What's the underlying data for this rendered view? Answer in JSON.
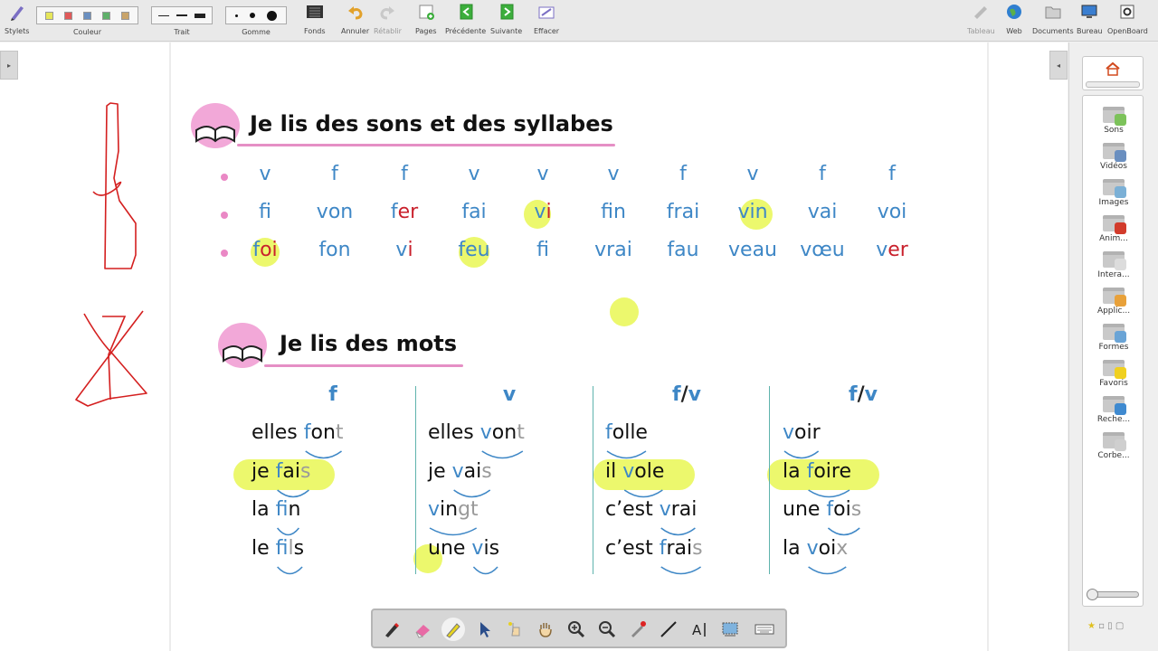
{
  "toolbar": {
    "stylets": "Stylets",
    "couleur": "Couleur",
    "trait": "Trait",
    "gomme": "Gomme",
    "fonds": "Fonds",
    "annuler": "Annuler",
    "retablir": "Rétablir",
    "pages": "Pages",
    "precedente": "Précédente",
    "suivante": "Suivante",
    "effacer": "Effacer",
    "tableau": "Tableau",
    "web": "Web",
    "documents": "Documents",
    "bureau": "Bureau",
    "openboard": "OpenBoard",
    "colors": [
      "#e6e65a",
      "#e05a5a",
      "#6a8fc0",
      "#5fb06a",
      "#c9a46a"
    ]
  },
  "lesson": {
    "title1": "Je lis des sons et des syllabes",
    "title2": "Je lis des mots",
    "row1": [
      "v",
      "f",
      "f",
      "v",
      "v",
      "v",
      "f",
      "v",
      "f",
      "f"
    ],
    "row2": [
      [
        [
          "f",
          "blue"
        ],
        [
          "i",
          "red"
        ]
      ],
      [
        [
          "v",
          "blue"
        ],
        [
          "on",
          "blue"
        ]
      ],
      [
        [
          "f",
          "blue"
        ],
        [
          "er",
          "red"
        ]
      ],
      [
        [
          "f",
          "blue"
        ],
        [
          "ai",
          "blue"
        ]
      ],
      [
        [
          "v",
          "blue"
        ],
        [
          "i",
          "red"
        ]
      ],
      [
        [
          "f",
          "blue"
        ],
        [
          "in",
          "blue"
        ]
      ],
      [
        [
          "fr",
          "blue"
        ],
        [
          "ai",
          "blue"
        ]
      ],
      [
        [
          "v",
          "blue"
        ],
        [
          "in",
          "blue"
        ]
      ],
      [
        [
          "v",
          "blue"
        ],
        [
          "ai",
          "blue"
        ]
      ],
      [
        [
          "v",
          "blue"
        ],
        [
          "oi",
          "blue"
        ]
      ]
    ],
    "row3": [
      [
        [
          "f",
          "blue"
        ],
        [
          "oi",
          "red"
        ]
      ],
      [
        [
          "f",
          "blue"
        ],
        [
          "on",
          "blue"
        ]
      ],
      [
        [
          "v",
          "blue"
        ],
        [
          "i",
          "red"
        ]
      ],
      [
        [
          "f",
          "blue"
        ],
        [
          "eu",
          "blue"
        ]
      ],
      [
        [
          "f",
          "blue"
        ],
        [
          "i",
          "red"
        ]
      ],
      [
        [
          "vr",
          "blue"
        ],
        [
          "ai",
          "blue"
        ]
      ],
      [
        [
          "f",
          "blue"
        ],
        [
          "au",
          "blue"
        ]
      ],
      [
        [
          "v",
          "blue"
        ],
        [
          "eau",
          "blue"
        ]
      ],
      [
        [
          "v",
          "blue"
        ],
        [
          "œu",
          "blue"
        ]
      ],
      [
        [
          "v",
          "blue"
        ],
        [
          "er",
          "red"
        ]
      ]
    ],
    "columns": [
      {
        "head_a": "f",
        "head_b": "",
        "words": [
          [
            [
              "elles ",
              "k"
            ],
            [
              "f",
              "b"
            ],
            [
              "on",
              "k"
            ],
            [
              "t",
              "g"
            ]
          ],
          [
            [
              "je ",
              "k"
            ],
            [
              "f",
              "b"
            ],
            [
              "ai",
              "k"
            ],
            [
              "s",
              "g"
            ]
          ],
          [
            [
              "la ",
              "k"
            ],
            [
              "f",
              "b"
            ],
            [
              "in",
              "k"
            ]
          ],
          [
            [
              "le ",
              "k"
            ],
            [
              "f",
              "b"
            ],
            [
              "i",
              "k"
            ],
            [
              "l",
              "g"
            ],
            [
              "s",
              "k"
            ]
          ]
        ]
      },
      {
        "head_a": "v",
        "head_b": "",
        "words": [
          [
            [
              "elles ",
              "k"
            ],
            [
              "v",
              "b"
            ],
            [
              "on",
              "k"
            ],
            [
              "t",
              "g"
            ]
          ],
          [
            [
              "je ",
              "k"
            ],
            [
              "v",
              "b"
            ],
            [
              "ai",
              "k"
            ],
            [
              "s",
              "g"
            ]
          ],
          [
            [
              "v",
              "b"
            ],
            [
              "in",
              "k"
            ],
            [
              "gt",
              "g"
            ]
          ],
          [
            [
              "une ",
              "k"
            ],
            [
              "v",
              "b"
            ],
            [
              "is",
              "k"
            ]
          ]
        ]
      },
      {
        "head_a": "f",
        "head_b": "v",
        "words": [
          [
            [
              "f",
              "b"
            ],
            [
              "olle",
              "k"
            ]
          ],
          [
            [
              "il ",
              "k"
            ],
            [
              "v",
              "b"
            ],
            [
              "ole",
              "k"
            ]
          ],
          [
            [
              "c’est ",
              "k"
            ],
            [
              "v",
              "b"
            ],
            [
              "rai",
              "k"
            ]
          ],
          [
            [
              "c’est ",
              "k"
            ],
            [
              "f",
              "b"
            ],
            [
              "rai",
              "k"
            ],
            [
              "s",
              "g"
            ]
          ]
        ]
      },
      {
        "head_a": "f",
        "head_b": "v",
        "words": [
          [
            [
              "v",
              "b"
            ],
            [
              "oir",
              "k"
            ]
          ],
          [
            [
              "la ",
              "k"
            ],
            [
              "f",
              "b"
            ],
            [
              "oire",
              "k"
            ]
          ],
          [
            [
              "une ",
              "k"
            ],
            [
              "f",
              "b"
            ],
            [
              "oi",
              "k"
            ],
            [
              "s",
              "g"
            ]
          ],
          [
            [
              "la ",
              "k"
            ],
            [
              "v",
              "b"
            ],
            [
              "oi",
              "k"
            ],
            [
              "x",
              "g"
            ]
          ]
        ]
      }
    ]
  },
  "library": {
    "items": [
      {
        "label": "Sons",
        "icon": "sound-folder-icon",
        "color": "#7cc25a"
      },
      {
        "label": "Vidéos",
        "icon": "video-folder-icon",
        "color": "#6a8fc0"
      },
      {
        "label": "Images",
        "icon": "image-folder-icon",
        "color": "#7bb0d6"
      },
      {
        "label": "Anim...",
        "icon": "animation-folder-icon",
        "color": "#d23b2b"
      },
      {
        "label": "Intera...",
        "icon": "interactive-folder-icon",
        "color": "#dcdcdc"
      },
      {
        "label": "Applic...",
        "icon": "application-folder-icon",
        "color": "#e8a13a"
      },
      {
        "label": "Formes",
        "icon": "shapes-folder-icon",
        "color": "#6aa4d6"
      },
      {
        "label": "Favoris",
        "icon": "favorites-folder-icon",
        "color": "#f0d020"
      },
      {
        "label": "Reche...",
        "icon": "search-folder-icon",
        "color": "#3f8ad0"
      },
      {
        "label": "Corbe...",
        "icon": "trash-icon",
        "color": "#cfcfcf"
      }
    ]
  }
}
